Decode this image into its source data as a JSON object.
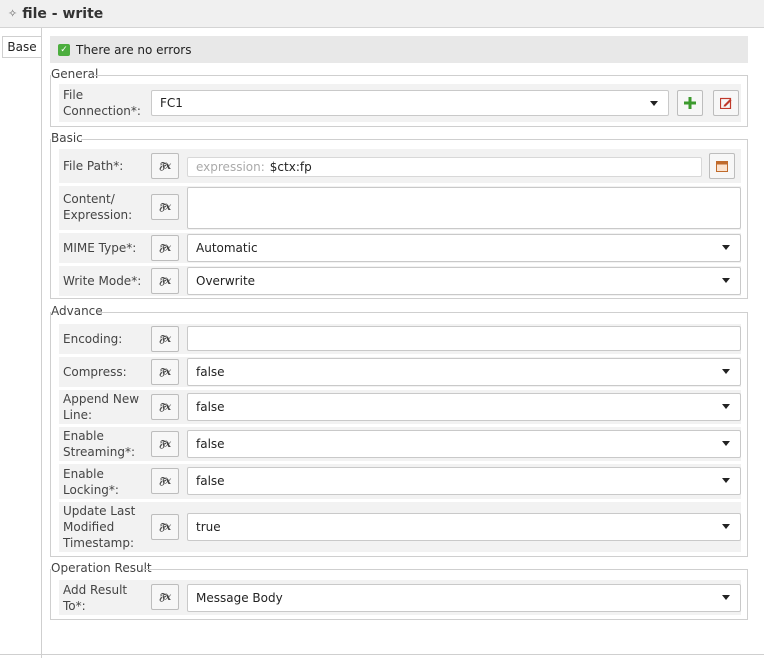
{
  "window": {
    "title": "file -  write"
  },
  "tabs": [
    {
      "label": "Base"
    }
  ],
  "status": {
    "text": "There are no errors"
  },
  "general": {
    "legend": "General",
    "file_connection": {
      "label_line1": "File",
      "label_line2": "Connection*:",
      "value": "FC1"
    }
  },
  "basic": {
    "legend": "Basic",
    "file_path": {
      "label": "File Path*:",
      "placeholder": "expression:",
      "value": "$ctx:fp"
    },
    "content": {
      "label_line1": "Content/",
      "label_line2": "Expression:",
      "value": ""
    },
    "mime_type": {
      "label": "MIME Type*:",
      "value": "Automatic"
    },
    "write_mode": {
      "label": "Write Mode*:",
      "value": "Overwrite"
    }
  },
  "advance": {
    "legend": "Advance",
    "encoding": {
      "label": "Encoding:",
      "value": ""
    },
    "compress": {
      "label": "Compress:",
      "value": "false"
    },
    "append_new_line": {
      "label_line1": "Append New",
      "label_line2": "Line:",
      "value": "false"
    },
    "enable_streaming": {
      "label_line1": "Enable",
      "label_line2": "Streaming*:",
      "value": "false"
    },
    "enable_locking": {
      "label_line1": "Enable",
      "label_line2": "Locking*:",
      "value": "false"
    },
    "update_timestamp": {
      "label_line1": "Update Last",
      "label_line2": "Modified",
      "label_line3": "Timestamp:",
      "value": "true"
    }
  },
  "operation_result": {
    "legend": "Operation Result",
    "add_result_to": {
      "label_line1": "Add Result",
      "label_line2": "To*:",
      "value": "Message Body"
    }
  },
  "icons": {
    "fx": "𝔉x",
    "title": "✧",
    "check": "✓"
  },
  "colors": {
    "check_green": "#4cae3e",
    "add_green": "#3c9a2e",
    "edit_red": "#c0392b"
  }
}
